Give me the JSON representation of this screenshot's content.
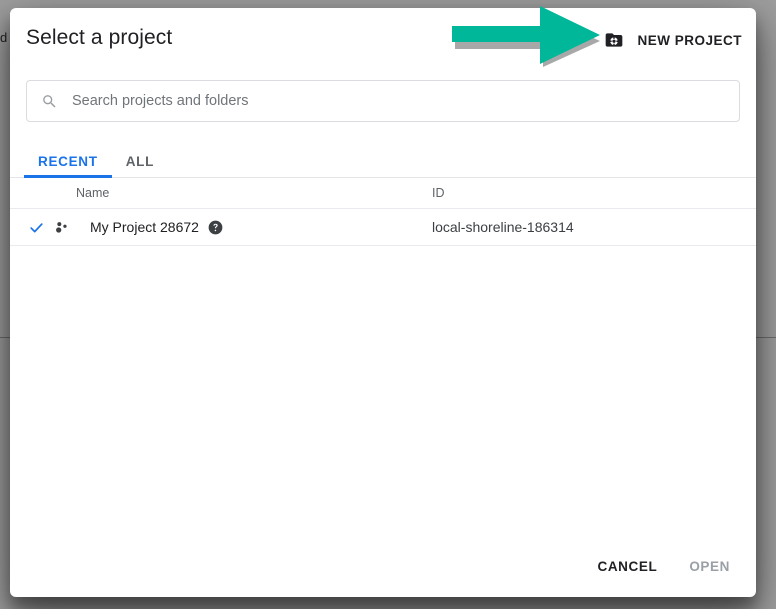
{
  "background": {
    "left_edge_text": "d"
  },
  "dialog": {
    "title": "Select a project",
    "new_project": {
      "label": "NEW PROJECT",
      "icon": "folder-plus-icon"
    },
    "search": {
      "placeholder": "Search projects and folders",
      "value": "",
      "icon": "search-icon"
    },
    "tabs": [
      {
        "label": "RECENT",
        "active": true
      },
      {
        "label": "ALL",
        "active": false
      }
    ],
    "table": {
      "columns": [
        "Name",
        "ID"
      ],
      "rows": [
        {
          "selected": true,
          "check_icon": "check-icon",
          "type_icon": "project-dots-icon",
          "name": "My Project 28672",
          "help_icon": "help-circle-icon",
          "id": "local-shoreline-186314"
        }
      ]
    },
    "footer": {
      "cancel_label": "CANCEL",
      "open_label": "OPEN"
    }
  },
  "annotation": {
    "type": "arrow",
    "direction": "right",
    "color": "#00b899",
    "points_to": "new-project-icon"
  },
  "colors": {
    "accent_blue": "#1a73e8",
    "text_primary": "#202124",
    "text_secondary": "#5f6368",
    "disabled": "#9aa0a6",
    "backdrop": "#9e9e9e",
    "arrow_teal": "#00b899"
  }
}
